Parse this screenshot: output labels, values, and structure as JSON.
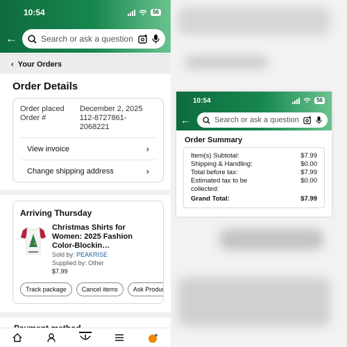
{
  "colors": {
    "header_green": "#0e6b3e",
    "link_blue": "#2162a1",
    "prime_orange": "#f08804"
  },
  "left_phone": {
    "status_time": "10:54",
    "battery": "56",
    "search_placeholder": "Search or ask a question",
    "breadcrumb": "Your Orders",
    "page_title": "Order Details",
    "order_placed_label": "Order placed",
    "order_placed_value": "December 2, 2025",
    "order_number_label": "Order #",
    "order_number_value": "112-8727861-2068221",
    "view_invoice": "View invoice",
    "change_address": "Change shipping address",
    "arriving": "Arriving Thursday",
    "product_name": "Christmas Shirts for Women: 2025 Fashion Color-Blockin…",
    "sold_by_label": "Sold by:",
    "sold_by_value": "PEAKRISE",
    "supplied_by": "Supplied by: Other",
    "price": "$7.99",
    "actions": [
      "Track package",
      "Cancel items",
      "Ask Produc"
    ],
    "payment_title": "Payment method",
    "nav_icons": [
      "home-icon",
      "account-icon",
      "rufus-icon",
      "menu-icon",
      "profile-icon"
    ]
  },
  "right_phone": {
    "status_time": "10:54",
    "battery": "56",
    "search_placeholder": "Search or ask a question",
    "summary_title": "Order Summary",
    "rows": [
      {
        "label": "Item(s) Subtotal:",
        "value": "$7.99"
      },
      {
        "label": "Shipping & Handling:",
        "value": "$0.00"
      },
      {
        "label": "Total before tax:",
        "value": "$7.99"
      },
      {
        "label": "Estimated tax to be collected:",
        "value": "$0.00"
      }
    ],
    "grand_total_label": "Grand Total:",
    "grand_total_value": "$7.99"
  }
}
